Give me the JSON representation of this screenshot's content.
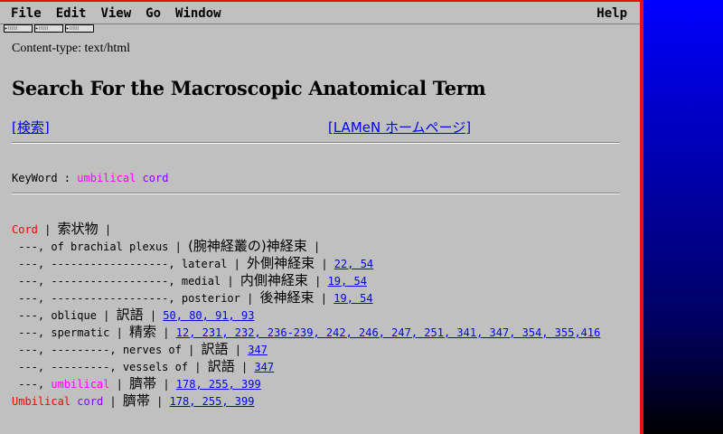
{
  "menu": {
    "file": "File",
    "edit": "Edit",
    "view": "View",
    "go": "Go",
    "window": "Window",
    "help": "Help"
  },
  "content_type": "Content-type: text/html",
  "page_title": "Search For the Macroscopic Anatomical Term",
  "links": {
    "search": "[検索] ",
    "home": "[LAMeN ホームページ]"
  },
  "keyword": {
    "label": "KeyWord :",
    "word1": "umbilical",
    "word2": "cord"
  },
  "rows": [
    {
      "prefix": "",
      "hl1": "Cord",
      "hl2": "",
      "mid": " | ",
      "jp": "索状物",
      "sep": " |",
      "pages": ""
    },
    {
      "prefix": " ---, of brachial plexus | ",
      "hl1": "",
      "hl2": "",
      "mid": "",
      "jp": "(腕神経叢の)神経束",
      "sep": " |",
      "pages": ""
    },
    {
      "prefix": " ---, ------------------, lateral | ",
      "hl1": "",
      "hl2": "",
      "mid": "",
      "jp": "外側神経束",
      "sep": " | ",
      "pages": "22, 54"
    },
    {
      "prefix": " ---, ------------------, medial | ",
      "hl1": "",
      "hl2": "",
      "mid": "",
      "jp": "内側神経束",
      "sep": " | ",
      "pages": "19, 54"
    },
    {
      "prefix": " ---, ------------------, posterior | ",
      "hl1": "",
      "hl2": "",
      "mid": "",
      "jp": "後神経束",
      "sep": " | ",
      "pages": "19, 54"
    },
    {
      "prefix": " ---, oblique | ",
      "hl1": "",
      "hl2": "",
      "mid": "",
      "jp": "訳語",
      "sep": " | ",
      "pages": "50, 80, 91, 93"
    },
    {
      "prefix": " ---, spermatic | ",
      "hl1": "",
      "hl2": "",
      "mid": "",
      "jp": "精索",
      "sep": " | ",
      "pages": "12, 231, 232, 236-239, 242, 246, 247, 251, 341, 347, 354, 355,416"
    },
    {
      "prefix": " ---, ---------, nerves of | ",
      "hl1": "",
      "hl2": "",
      "mid": "",
      "jp": "訳語",
      "sep": " | ",
      "pages": "347"
    },
    {
      "prefix": " ---, ---------, vessels of | ",
      "hl1": "",
      "hl2": "",
      "mid": "",
      "jp": "訳語",
      "sep": " | ",
      "pages": "347"
    },
    {
      "prefix": " ---, ",
      "hl1": "",
      "hl2": "umbilical",
      "mid": " | ",
      "jp": "臍帯",
      "sep": " | ",
      "pages": "178, 255, 399"
    },
    {
      "prefix": "",
      "hl1": "Umbilical",
      "hl2": "",
      "hl3": "cord",
      "mid": " | ",
      "jp": "臍帯",
      "sep": " | ",
      "pages": "178, 255, 399"
    }
  ],
  "colors": {
    "highlight_red": "#ff0000",
    "highlight_magenta": "#ff00ff",
    "highlight_purple": "#8800ff",
    "link": "#0000ee",
    "window_bg": "#c0c0c0",
    "window_border": "#e81010"
  }
}
